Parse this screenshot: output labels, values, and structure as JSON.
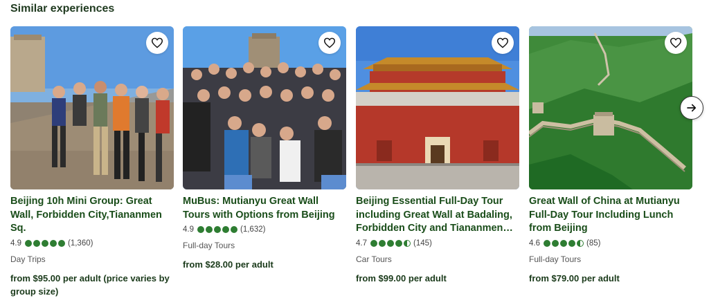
{
  "section_title": "Similar experiences",
  "colors": {
    "brand_green": "#2e7d32",
    "title_green": "#1a4d1a"
  },
  "cards": [
    {
      "title": "Beijing 10h Mini Group: Great Wall, Forbidden City,Tiananmen Sq.",
      "score": "4.9",
      "rating_value": 5,
      "reviews": "(1,360)",
      "category": "Day Trips",
      "price": "from $95.00 per adult (price varies by group size)"
    },
    {
      "title": "MuBus: Mutianyu Great Wall Tours with Options from Beijing",
      "score": "4.9",
      "rating_value": 5,
      "reviews": "(1,632)",
      "category": "Full-day Tours",
      "price": "from $28.00 per adult"
    },
    {
      "title": "Beijing Essential Full-Day Tour including Great Wall at Badaling, Forbidden City and Tiananmen…",
      "score": "4.7",
      "rating_value": 4.5,
      "reviews": "(145)",
      "category": "Car Tours",
      "price": "from $99.00 per adult"
    },
    {
      "title": "Great Wall of China at Mutianyu Full-Day Tour Including Lunch from Beijing",
      "score": "4.6",
      "rating_value": 4.5,
      "reviews": "(85)",
      "category": "Full-day Tours",
      "price": "from $79.00 per adult"
    }
  ],
  "icons": {
    "favorite": "heart-icon",
    "next": "arrow-right-icon",
    "rating": "rating-dot-icon"
  }
}
